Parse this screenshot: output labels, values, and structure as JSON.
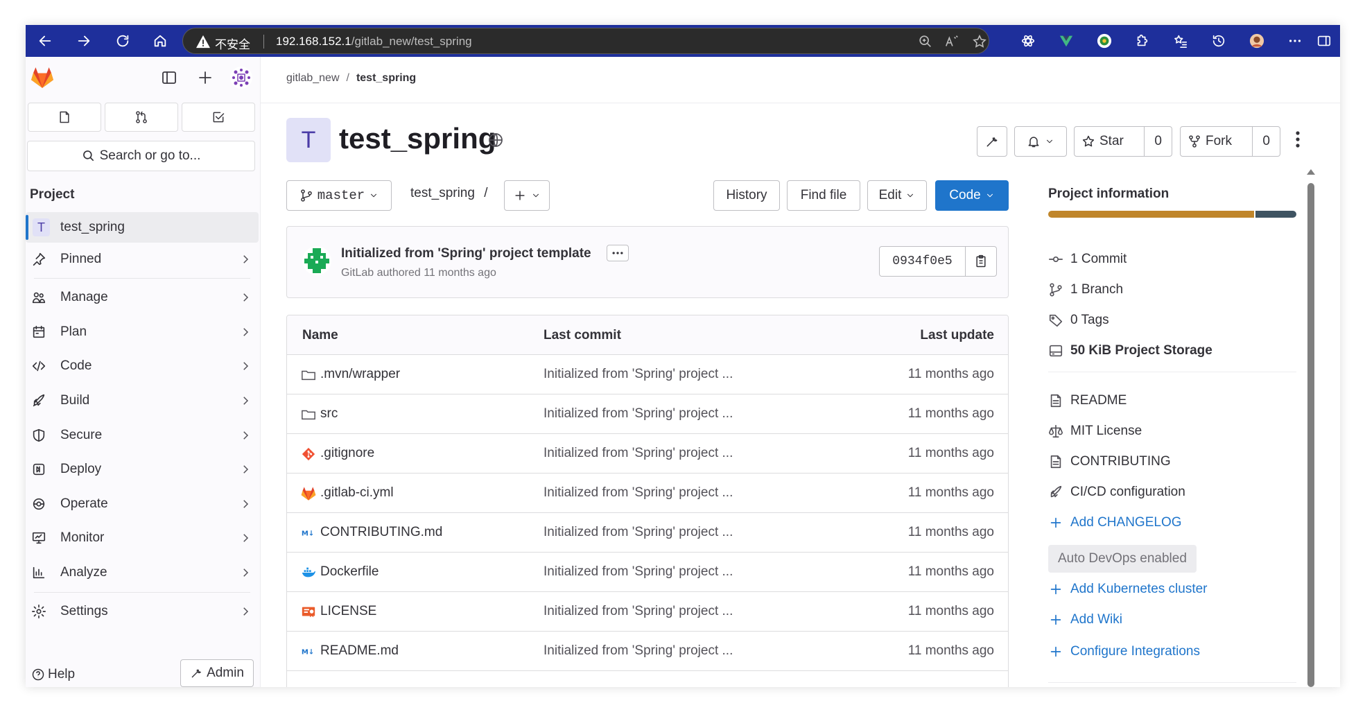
{
  "browser": {
    "security_label": "不安全",
    "url_host": "192.168.152.1",
    "url_path": "/gitlab_new/test_spring"
  },
  "sidebar": {
    "search_placeholder": "Search or go to...",
    "section_label": "Project",
    "project": {
      "avatar_letter": "T",
      "name": "test_spring"
    },
    "items": [
      {
        "label": "Pinned",
        "icon": "pin-icon"
      },
      {
        "label": "Manage",
        "icon": "users-icon"
      },
      {
        "label": "Plan",
        "icon": "calendar-icon"
      },
      {
        "label": "Code",
        "icon": "code-icon"
      },
      {
        "label": "Build",
        "icon": "rocket-icon"
      },
      {
        "label": "Secure",
        "icon": "shield-icon"
      },
      {
        "label": "Deploy",
        "icon": "deploy-icon"
      },
      {
        "label": "Operate",
        "icon": "operate-icon"
      },
      {
        "label": "Monitor",
        "icon": "monitor-icon"
      },
      {
        "label": "Analyze",
        "icon": "chart-icon"
      },
      {
        "label": "Settings",
        "icon": "settings-icon"
      }
    ],
    "help_label": "Help",
    "admin_label": "Admin"
  },
  "breadcrumb": {
    "group": "gitlab_new",
    "project": "test_spring"
  },
  "project": {
    "avatar_letter": "T",
    "title": "test_spring",
    "star_label": "Star",
    "star_count": "0",
    "fork_label": "Fork",
    "fork_count": "0"
  },
  "repo_toolbar": {
    "branch": "master",
    "path": "test_spring",
    "path_sep": "/",
    "history_label": "History",
    "find_file_label": "Find file",
    "edit_label": "Edit",
    "code_label": "Code"
  },
  "last_commit": {
    "message": "Initialized from 'Spring' project template",
    "author_line": "GitLab authored 11 months ago",
    "sha": "0934f0e5"
  },
  "file_table": {
    "headers": {
      "name": "Name",
      "commit": "Last commit",
      "update": "Last update"
    },
    "rows": [
      {
        "name": ".mvn/wrapper",
        "icon": "folder-icon",
        "commit": "Initialized from 'Spring' project ...",
        "updated": "11 months ago"
      },
      {
        "name": "src",
        "icon": "folder-icon",
        "commit": "Initialized from 'Spring' project ...",
        "updated": "11 months ago"
      },
      {
        "name": ".gitignore",
        "icon": "git-icon",
        "commit": "Initialized from 'Spring' project ...",
        "updated": "11 months ago"
      },
      {
        "name": ".gitlab-ci.yml",
        "icon": "gitlab-icon",
        "commit": "Initialized from 'Spring' project ...",
        "updated": "11 months ago"
      },
      {
        "name": "CONTRIBUTING.md",
        "icon": "markdown-icon",
        "commit": "Initialized from 'Spring' project ...",
        "updated": "11 months ago"
      },
      {
        "name": "Dockerfile",
        "icon": "docker-icon",
        "commit": "Initialized from 'Spring' project ...",
        "updated": "11 months ago"
      },
      {
        "name": "LICENSE",
        "icon": "license-icon",
        "commit": "Initialized from 'Spring' project ...",
        "updated": "11 months ago"
      },
      {
        "name": "README.md",
        "icon": "markdown-icon",
        "commit": "Initialized from 'Spring' project ...",
        "updated": "11 months ago"
      }
    ]
  },
  "project_info": {
    "title": "Project information",
    "language_colors": [
      "#c0862b",
      "#3f5462"
    ],
    "commits": "1 Commit",
    "branches": "1 Branch",
    "tags": "0 Tags",
    "storage": "50 KiB Project Storage",
    "readme": "README",
    "license": "MIT License",
    "contributing": "CONTRIBUTING",
    "cicd": "CI/CD configuration",
    "add_changelog": "Add CHANGELOG",
    "auto_devops": "Auto DevOps enabled",
    "add_k8s": "Add Kubernetes cluster",
    "add_wiki": "Add Wiki",
    "configure_integrations": "Configure Integrations"
  },
  "colors": {
    "browser_bar": "#1e2f9b",
    "primary": "#1f75cb",
    "tanuki": "#e24329"
  }
}
